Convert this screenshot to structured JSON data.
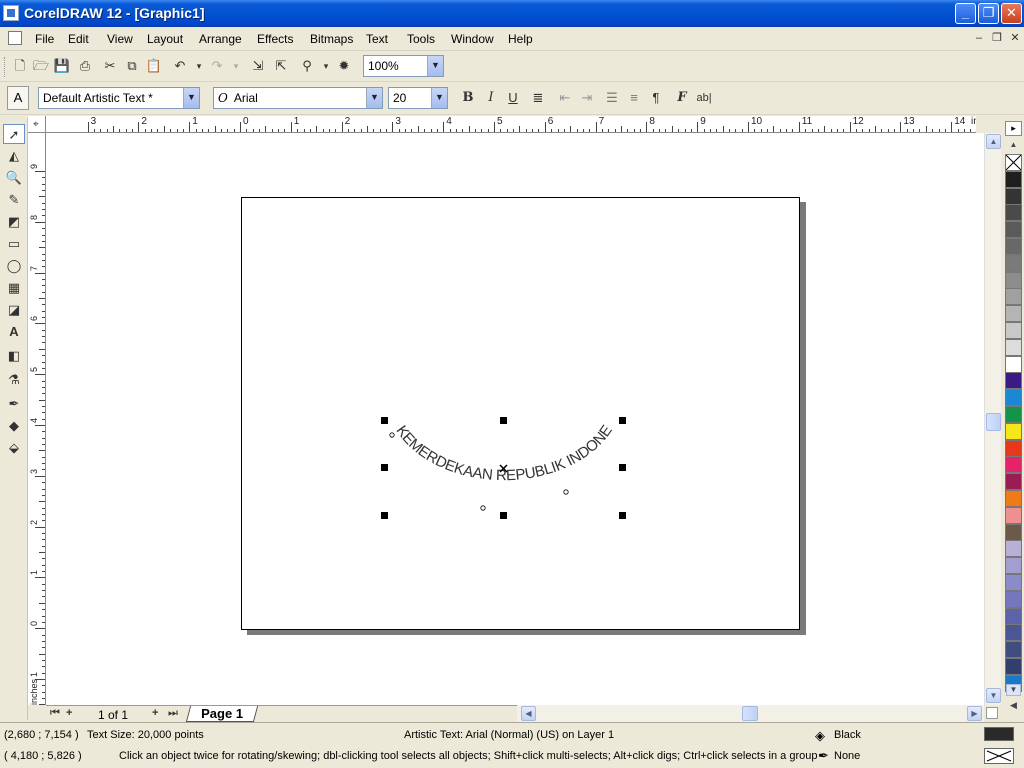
{
  "window": {
    "title": "CorelDRAW 12 - [Graphic1]",
    "buttons": {
      "minimize": "_",
      "restore": "❐",
      "close": "✕"
    }
  },
  "menu": [
    "File",
    "Edit",
    "View",
    "Layout",
    "Arrange",
    "Effects",
    "Bitmaps",
    "Text",
    "Tools",
    "Window",
    "Help"
  ],
  "standard_toolbar": {
    "zoom_value": "100%"
  },
  "property_bar": {
    "style": "Default Artistic Text *",
    "font": "Arial",
    "font_size": "20"
  },
  "rulers": {
    "unit": "inches",
    "h_labels": [
      "3",
      "2",
      "1",
      "0",
      "1",
      "2",
      "3",
      "4",
      "5",
      "6",
      "7",
      "8",
      "9",
      "10",
      "11",
      "12",
      "13",
      "14"
    ],
    "v_labels": [
      "9",
      "8",
      "7",
      "6",
      "5",
      "4",
      "3",
      "2",
      "1",
      "0",
      "1"
    ],
    "v_unit": "inches"
  },
  "canvas": {
    "arc_text": "KEMERDEKAAN REPUBLIK INDONESIA"
  },
  "page_nav": {
    "page_count": "1 of 1",
    "tab_label": "Page 1"
  },
  "palette": {
    "colors": [
      "none",
      "#1e1e1e",
      "#343434",
      "#4a4a4a",
      "#5a5a5a",
      "#686868",
      "#7a7a7a",
      "#8c8c8c",
      "#a0a0a0",
      "#b4b4b4",
      "#c8c8c8",
      "#dcdcdc",
      "#ffffff",
      "#3b1a86",
      "#1b87d5",
      "#14944a",
      "#f5e71a",
      "#e8371b",
      "#e6226b",
      "#9b1b53",
      "#ef7a17",
      "#f08f8f",
      "#6b5a4a",
      "#b8b0d6",
      "#a29fd0",
      "#8c8bc9",
      "#7576bb",
      "#5c63a8",
      "#4b5793",
      "#3f4d80",
      "#323f6e",
      "#1a78c8"
    ]
  },
  "status": {
    "coords1": "(2,680 ; 7,154 )",
    "text_size": "Text Size: 20,000 points",
    "object_info": "Artistic Text: Arial (Normal) (US) on Layer 1",
    "fill_label": "Black",
    "coords2": "( 4,180 ; 5,826  )",
    "hint": "Click an object twice for rotating/skewing; dbl-clicking tool selects all objects; Shift+click multi-selects; Alt+click digs; Ctrl+click selects in a group",
    "outline_label": "None",
    "fill_color": "#2a2a2a"
  }
}
